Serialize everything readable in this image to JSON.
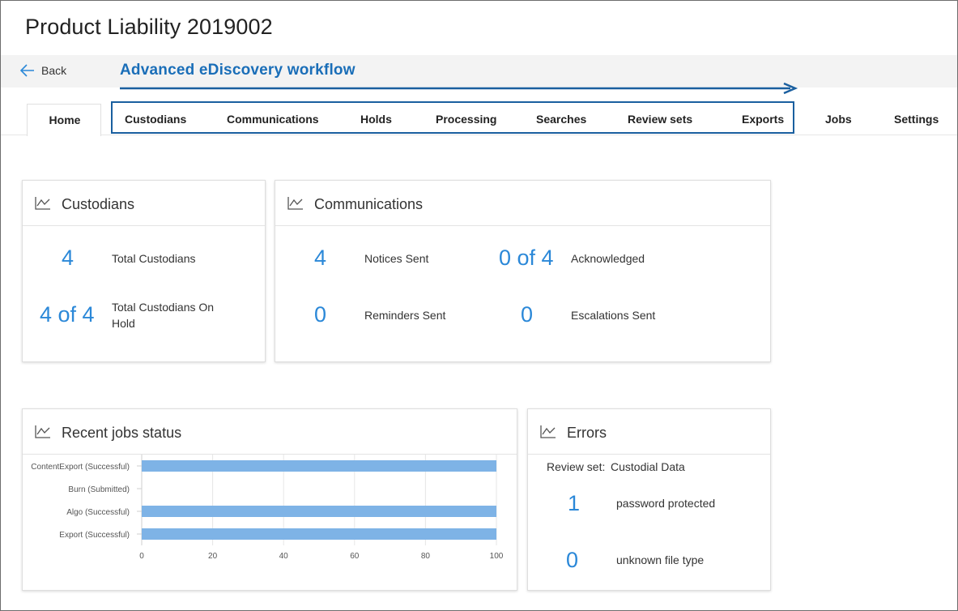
{
  "page": {
    "title": "Product Liability 2019002"
  },
  "nav": {
    "back_label": "Back",
    "workflow_label": "Advanced eDiscovery workflow",
    "tabs": [
      {
        "label": "Home",
        "selected": true
      },
      {
        "label": "Custodians"
      },
      {
        "label": "Communications"
      },
      {
        "label": "Holds"
      },
      {
        "label": "Processing"
      },
      {
        "label": "Searches"
      },
      {
        "label": "Review sets"
      },
      {
        "label": "Exports"
      },
      {
        "label": "Jobs"
      },
      {
        "label": "Settings"
      }
    ]
  },
  "custodians_card": {
    "title": "Custodians",
    "icon": "line-chart-icon",
    "stats": [
      {
        "value": "4",
        "label": "Total Custodians"
      },
      {
        "value": "4 of 4",
        "label": "Total Custodians On Hold"
      }
    ]
  },
  "communications_card": {
    "title": "Communications",
    "icon": "line-chart-icon",
    "stats": [
      {
        "value": "4",
        "label": "Notices Sent"
      },
      {
        "value": "0 of 4",
        "label": "Acknowledged"
      },
      {
        "value": "0",
        "label": "Reminders Sent"
      },
      {
        "value": "0",
        "label": "Escalations Sent"
      }
    ]
  },
  "jobs_card": {
    "title": "Recent jobs status",
    "icon": "line-chart-icon"
  },
  "errors_card": {
    "title": "Errors",
    "icon": "line-chart-icon",
    "review_set_label": "Review set:",
    "review_set_value": "Custodial Data",
    "stats": [
      {
        "value": "1",
        "label": "password protected"
      },
      {
        "value": "0",
        "label": "unknown file type"
      }
    ]
  },
  "colors": {
    "accent": "#2b88d8",
    "workflow": "#1a6eb8",
    "bar": "#7eb3e6"
  },
  "chart_data": {
    "type": "bar",
    "orientation": "horizontal",
    "categories": [
      "ContentExport (Successful)",
      "Burn (Submitted)",
      "Algo (Successful)",
      "Export (Successful)"
    ],
    "values": [
      100,
      0,
      100,
      100
    ],
    "xlim": [
      0,
      100
    ],
    "xticks": [
      0,
      20,
      40,
      60,
      80,
      100
    ],
    "grid": true
  }
}
